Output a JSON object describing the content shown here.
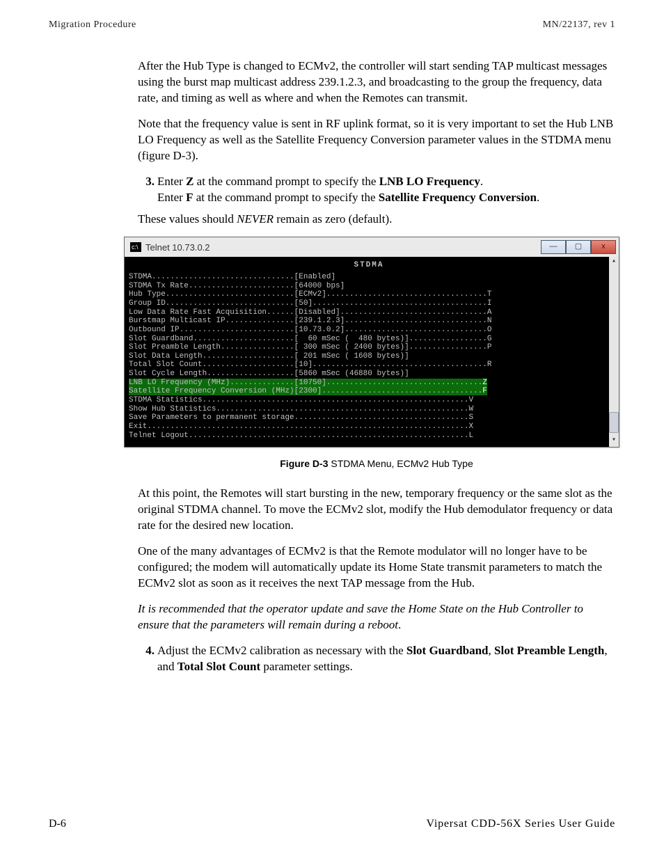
{
  "header": {
    "left": "Migration Procedure",
    "right": "MN/22137, rev 1"
  },
  "para1": "After the Hub Type is changed to ECMv2, the controller will start sending TAP multicast messages using the burst map multicast address 239.1.2.3, and broadcasting to the group the frequency, data rate, and timing as well as where and when the Remotes can transmit.",
  "para2": "Note that the frequency value is sent in RF uplink format, so it is very important to set the Hub LNB LO Frequency as well as the Satellite Frequency Conversion parameter values in the STDMA menu (figure D-3).",
  "step3": {
    "num": "3.",
    "line1a": "Enter ",
    "line1b": "Z",
    "line1c": " at the command prompt to specify the ",
    "line1d": "LNB LO Frequency",
    "line1e": ".",
    "line2a": "Enter ",
    "line2b": "F",
    "line2c": " at the command prompt to specify the ",
    "line2d": "Satellite Frequency Conversion",
    "line2e": "."
  },
  "step3_follow_a": "These values should ",
  "step3_follow_b": "NEVER",
  "step3_follow_c": " remain as zero (default).",
  "terminal": {
    "titlebar": "Telnet 10.73.0.2",
    "btn_min": "—",
    "btn_max": "▢",
    "btn_close": "x",
    "heading": "STDMA",
    "lines": [
      "STDMA...............................[Enabled]",
      "STDMA Tx Rate.......................[64000 bps]",
      "Hub Type............................[ECMv2]...................................T",
      "Group ID............................[50]......................................I",
      "Low Data Rate Fast Acquisition......[Disabled]................................A",
      "Burstmap Multicast IP...............[239.1.2.3]...............................N",
      "Outbound IP.........................[10.73.0.2]...............................O",
      "Slot Guardband......................[  60 mSec (  480 bytes)].................G",
      "Slot Preamble Length................[ 300 mSec ( 2400 bytes)].................P",
      "Slot Data Length....................[ 201 mSec ( 1608 bytes)]",
      "Total Slot Count....................[10]......................................R",
      "Slot Cycle Length...................[5860 mSec (46880 bytes)]"
    ],
    "hl1_a": "LNB LO Frequency (MHz)..............[10750]..................................",
    "hl1_b": "Z",
    "hl2_a": "Satellite Frequency Conversion (MHz)[2300]...................................",
    "hl2_b": "F",
    "after": [
      "STDMA Statistics..........................................................V",
      "Show Hub Statistics.......................................................W",
      "",
      "Save Parameters to permanent storage......................................S",
      "Exit......................................................................X",
      "Telnet Logout.............................................................L"
    ]
  },
  "caption": {
    "label": "Figure D-3",
    "text": "   STDMA Menu, ECMv2 Hub Type"
  },
  "para3": "At this point, the Remotes will start bursting in the new, temporary frequency or the same slot as the original STDMA channel. To move the ECMv2 slot, modify the Hub demodulator frequency or data rate for the desired new location.",
  "para4": "One of the many advantages of ECMv2 is that the Remote modulator will no longer have to be configured; the modem will automatically update its Home State transmit parameters to match the ECMv2 slot as soon as it receives the next TAP message from the Hub.",
  "para5": "It is recommended that the operator update and save the Home State on the Hub Controller to ensure that the parameters will remain during a reboot",
  "para5_end": ".",
  "step4": {
    "num": "4.",
    "a": "Adjust the ECMv2 calibration as necessary with the ",
    "b": "Slot Guardband",
    "c": ", ",
    "d": "Slot Preamble Length",
    "e": ", and ",
    "f": "Total Slot Count",
    "g": " parameter settings."
  },
  "footer": {
    "left": "D-6",
    "right": "Vipersat CDD-56X Series User Guide"
  }
}
